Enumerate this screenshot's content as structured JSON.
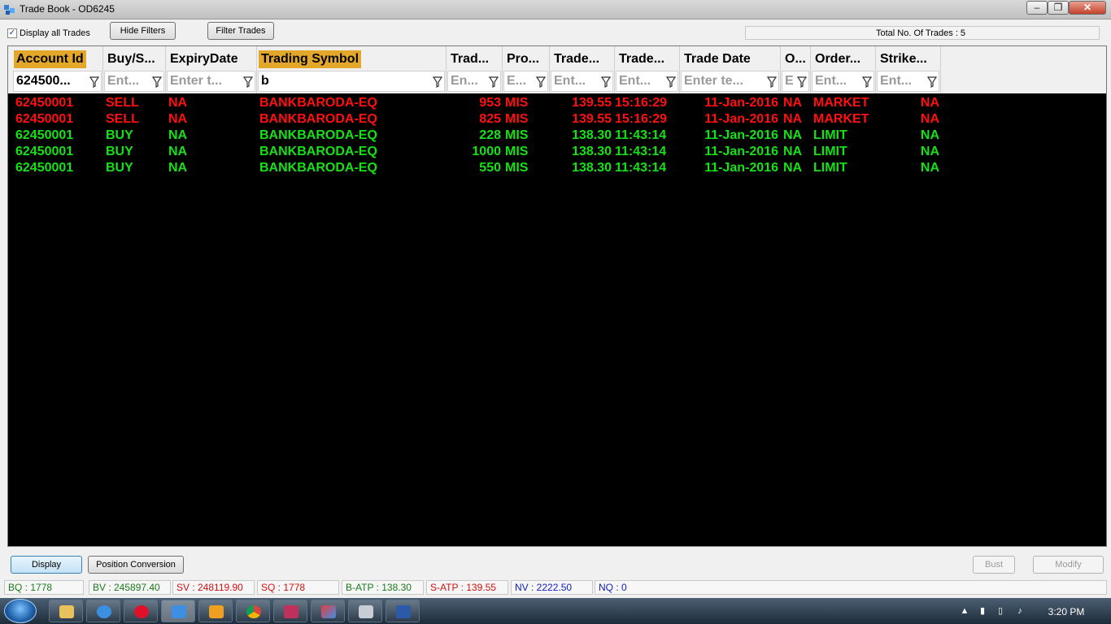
{
  "window": {
    "title": "Trade Book - OD6245"
  },
  "toolbar": {
    "display_all_label": "Display all Trades",
    "display_all_checked": "✓",
    "hide_filters": "Hide Filters",
    "filter_trades": "Filter Trades",
    "total_trades": "Total No. Of Trades : 5"
  },
  "grid": {
    "columns": [
      {
        "title": "Account Id",
        "filter": "624500...",
        "sorted": true,
        "filled": true
      },
      {
        "title": "Buy/S...",
        "filter": "Ent...",
        "sorted": false,
        "filled": false
      },
      {
        "title": "ExpiryDate",
        "filter": "Enter t...",
        "sorted": false,
        "filled": false
      },
      {
        "title": "Trading Symbol",
        "filter": "b",
        "sorted": true,
        "filled": true
      },
      {
        "title": "Trad...",
        "filter": "En...",
        "sorted": false,
        "filled": false
      },
      {
        "title": "Pro...",
        "filter": "E...",
        "sorted": false,
        "filled": false
      },
      {
        "title": "Trade...",
        "filter": "Ent...",
        "sorted": false,
        "filled": false
      },
      {
        "title": "Trade...",
        "filter": "Ent...",
        "sorted": false,
        "filled": false
      },
      {
        "title": "Trade Date",
        "filter": "Enter te...",
        "sorted": false,
        "filled": false
      },
      {
        "title": "O...",
        "filter": "E",
        "sorted": false,
        "filled": false
      },
      {
        "title": "Order...",
        "filter": "Ent...",
        "sorted": false,
        "filled": false
      },
      {
        "title": "Strike...",
        "filter": "Ent...",
        "sorted": false,
        "filled": false
      }
    ],
    "rows": [
      {
        "side": "sell",
        "account": "62450001",
        "buysell": "SELL",
        "expiry": "NA",
        "symbol": "BANKBARODA-EQ",
        "qty": "953",
        "product": "MIS",
        "price": "139.55",
        "time": "15:16:29",
        "date": "11-Jan-2016",
        "o": "NA",
        "order_type": "MARKET",
        "strike": "NA"
      },
      {
        "side": "sell",
        "account": "62450001",
        "buysell": "SELL",
        "expiry": "NA",
        "symbol": "BANKBARODA-EQ",
        "qty": "825",
        "product": "MIS",
        "price": "139.55",
        "time": "15:16:29",
        "date": "11-Jan-2016",
        "o": "NA",
        "order_type": "MARKET",
        "strike": "NA"
      },
      {
        "side": "buy",
        "account": "62450001",
        "buysell": "BUY",
        "expiry": "NA",
        "symbol": "BANKBARODA-EQ",
        "qty": "228",
        "product": "MIS",
        "price": "138.30",
        "time": "11:43:14",
        "date": "11-Jan-2016",
        "o": "NA",
        "order_type": "LIMIT",
        "strike": "NA"
      },
      {
        "side": "buy",
        "account": "62450001",
        "buysell": "BUY",
        "expiry": "NA",
        "symbol": "BANKBARODA-EQ",
        "qty": "1000",
        "product": "MIS",
        "price": "138.30",
        "time": "11:43:14",
        "date": "11-Jan-2016",
        "o": "NA",
        "order_type": "LIMIT",
        "strike": "NA"
      },
      {
        "side": "buy",
        "account": "62450001",
        "buysell": "BUY",
        "expiry": "NA",
        "symbol": "BANKBARODA-EQ",
        "qty": "550",
        "product": "MIS",
        "price": "138.30",
        "time": "11:43:14",
        "date": "11-Jan-2016",
        "o": "NA",
        "order_type": "LIMIT",
        "strike": "NA"
      }
    ]
  },
  "actions": {
    "display": "Display",
    "position_conversion": "Position Conversion",
    "bust": "Bust",
    "modify": "Modify"
  },
  "status": {
    "bq": "BQ : 1778",
    "bv": "BV : 245897.40",
    "sv": "SV : 248119.90",
    "sq": "SQ : 1778",
    "batp": "B-ATP : 138.30",
    "satp": "S-ATP : 139.55",
    "nv": "NV : 2222.50",
    "nq": "NQ : 0"
  },
  "colors": {
    "sell": "#ff0f0f",
    "buy": "#16e116",
    "sorted_header": "#e3a82a",
    "grid_background": "#000000",
    "status_green": "#1a7a1a",
    "status_red": "#d01010",
    "status_blue": "#1020c0"
  },
  "taskbar": {
    "icons": [
      "windows-start-icon",
      "file-explorer-icon",
      "internet-explorer-icon",
      "opera-icon",
      "trade-app-icon",
      "media-player-icon",
      "chrome-icon",
      "app-icon",
      "triangle-app-icon",
      "calculator-icon",
      "word-icon"
    ],
    "clock": "3:20 PM"
  }
}
